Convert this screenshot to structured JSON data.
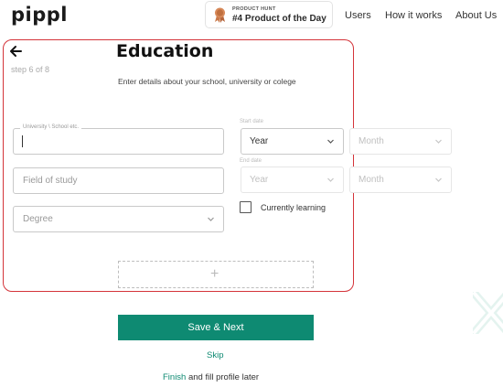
{
  "header": {
    "logo": "pippl",
    "badge": {
      "kicker": "PRODUCT HUNT",
      "title": "#4 Product of the Day"
    },
    "nav": [
      "Users",
      "How it works",
      "About Us"
    ]
  },
  "form": {
    "step": "step 6 of 8",
    "title": "Education",
    "subtitle": "Enter details about your school, university or colege",
    "school_label": "University \\ School etc.",
    "school_value": "",
    "field_of_study_placeholder": "Field of study",
    "degree_placeholder": "Degree",
    "start_date_label": "Start date",
    "start_year": "Year",
    "start_month": "Month",
    "end_date_label": "End date",
    "end_year": "Year",
    "end_month": "Month",
    "currently_learning_label": "Currently learning",
    "currently_learning_checked": false,
    "add_icon": "plus-icon"
  },
  "actions": {
    "save_next": "Save & Next",
    "skip": "Skip",
    "finish_link": "Finish",
    "finish_rest": " and fill profile later"
  },
  "colors": {
    "accent": "#0e8a72",
    "highlight_border": "#d4343a"
  }
}
